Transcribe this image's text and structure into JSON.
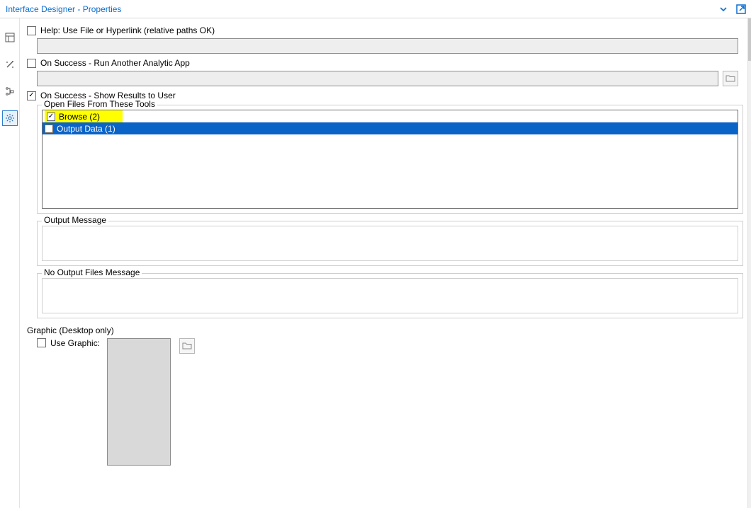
{
  "title": "Interface Designer - Properties",
  "checks": {
    "help": {
      "label": "Help: Use File or Hyperlink (relative paths OK)",
      "checked": false
    },
    "onSuccessRun": {
      "label": "On Success - Run Another Analytic App",
      "checked": false
    },
    "onSuccessShow": {
      "label": "On Success - Show Results to User",
      "checked": true
    }
  },
  "toolsFieldset": {
    "legend": "Open Files From These Tools",
    "items": [
      {
        "label": "Browse (2)",
        "checked": true,
        "highlight": true,
        "selected": false
      },
      {
        "label": "Output Data (1)",
        "checked": false,
        "highlight": false,
        "selected": true
      }
    ]
  },
  "outputMessage": {
    "legend": "Output Message"
  },
  "noOutputMessage": {
    "legend": "No Output Files Message"
  },
  "graphic": {
    "sectionLabel": "Graphic (Desktop only)",
    "useGraphicLabel": "Use Graphic:"
  }
}
